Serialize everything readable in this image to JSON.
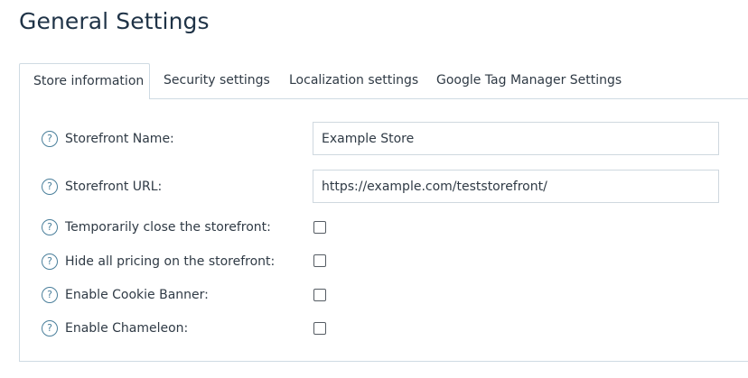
{
  "page": {
    "title": "General Settings"
  },
  "tabs": [
    {
      "label": "Store information",
      "active": true
    },
    {
      "label": "Security settings",
      "active": false
    },
    {
      "label": "Localization settings",
      "active": false
    },
    {
      "label": "Google Tag Manager Settings",
      "active": false
    }
  ],
  "help_glyph": "?",
  "fields": {
    "storefront_name": {
      "label": "Storefront Name:",
      "value": "Example Store"
    },
    "storefront_url": {
      "label": "Storefront URL:",
      "value": "https://example.com/teststorefront/"
    },
    "close_storefront": {
      "label": "Temporarily close the storefront:",
      "checked": false
    },
    "hide_pricing": {
      "label": "Hide all pricing on the storefront:",
      "checked": false
    },
    "cookie_banner": {
      "label": "Enable Cookie Banner:",
      "checked": false
    },
    "chameleon": {
      "label": "Enable Chameleon:",
      "checked": false
    }
  },
  "colors": {
    "accent": "#4a7f9b",
    "border": "#cfdbe3",
    "title": "#1f3347"
  }
}
